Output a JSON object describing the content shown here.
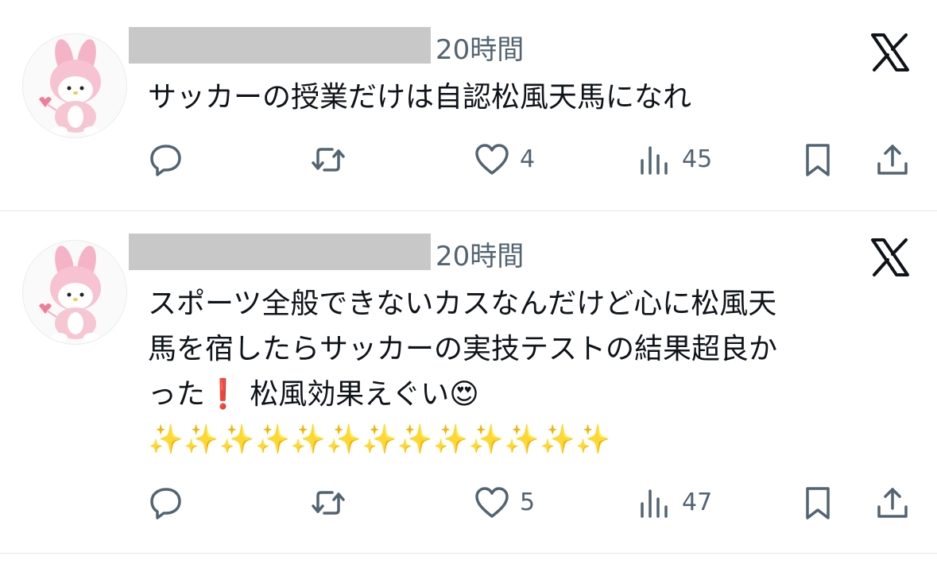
{
  "tweets": [
    {
      "time": "20時間",
      "text": "サッカーの授業だけは自認松風天馬になれ",
      "likes": "4",
      "views": "45"
    },
    {
      "time": "20時間",
      "text": "スポーツ全般できないカスなんだけど心に松風天\n馬を宿したらサッカーの実技テストの結果超良か\nった❗ 松風効果えぐい😍\n✨✨✨✨✨✨✨✨✨✨✨✨✨",
      "likes": "5",
      "views": "47"
    }
  ],
  "icons": {
    "reply": "reply-icon",
    "retweet": "retweet-icon",
    "like": "heart-icon",
    "views": "views-chart-icon",
    "bookmark": "bookmark-icon",
    "share": "share-icon",
    "brand": "x-logo-icon"
  },
  "colors": {
    "icon_gray": "#536471",
    "text": "#0f1419",
    "redaction": "#c8c8c8",
    "divider": "#e6e6e6"
  }
}
